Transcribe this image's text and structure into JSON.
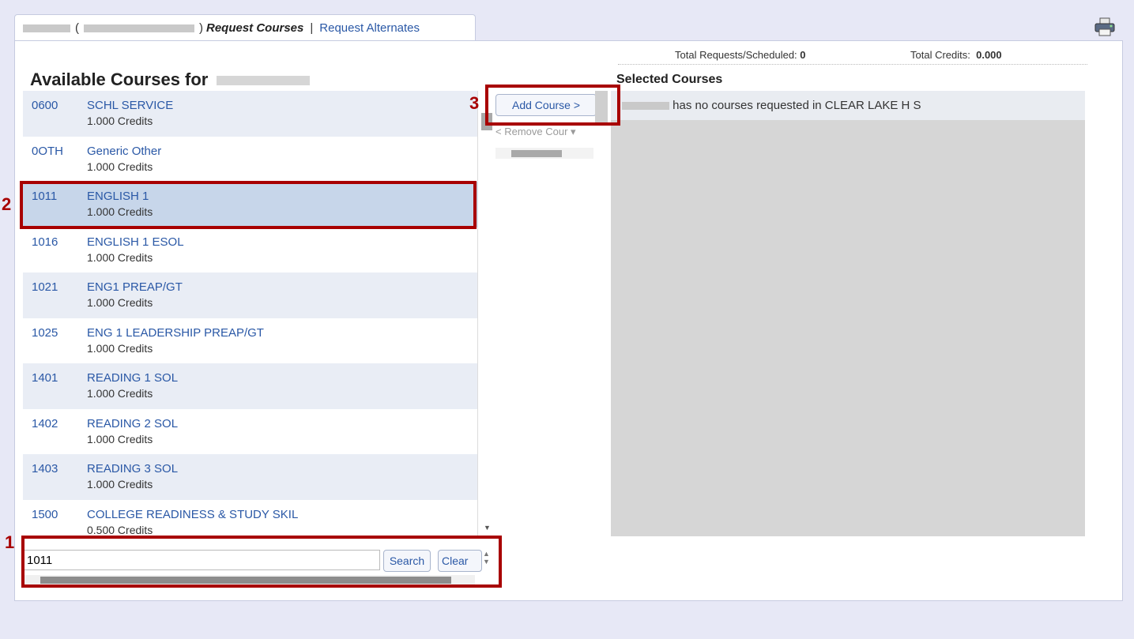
{
  "tabs": {
    "student_name_redacted": "",
    "open_paren": "(",
    "close_paren": ")",
    "active": "Request Courses",
    "separator": "|",
    "alternate": "Request Alternates"
  },
  "totals": {
    "requests_label": "Total Requests/Scheduled:",
    "requests_value": "0",
    "credits_label": "Total Credits:",
    "credits_value": "0.000"
  },
  "available": {
    "title": "Available Courses for",
    "courses": [
      {
        "code": "0600",
        "name": "SCHL SERVICE",
        "credits": "1.000 Credits"
      },
      {
        "code": "0OTH",
        "name": "Generic Other",
        "credits": "1.000 Credits"
      },
      {
        "code": "1011",
        "name": "ENGLISH 1",
        "credits": "1.000 Credits"
      },
      {
        "code": "1016",
        "name": "ENGLISH 1 ESOL",
        "credits": "1.000 Credits"
      },
      {
        "code": "1021",
        "name": "ENG1 PREAP/GT",
        "credits": "1.000 Credits"
      },
      {
        "code": "1025",
        "name": "ENG 1 LEADERSHIP PREAP/GT",
        "credits": "1.000 Credits"
      },
      {
        "code": "1401",
        "name": "READING 1 SOL",
        "credits": "1.000 Credits"
      },
      {
        "code": "1402",
        "name": "READING 2 SOL",
        "credits": "1.000 Credits"
      },
      {
        "code": "1403",
        "name": "READING 3 SOL",
        "credits": "1.000 Credits"
      },
      {
        "code": "1500",
        "name": "COLLEGE READINESS & STUDY SKIL",
        "credits": "0.500 Credits"
      }
    ]
  },
  "search": {
    "value": "1011",
    "search_label": "Search",
    "clear_label": "Clear"
  },
  "middle": {
    "add_label": "Add Course >",
    "remove_label": "< Remove Cour"
  },
  "selected": {
    "title": "Selected Courses",
    "message": "has no courses requested in CLEAR LAKE H S"
  },
  "callouts": {
    "n1": "1",
    "n2": "2",
    "n3": "3"
  },
  "colors": {
    "accent": "#a80000",
    "link": "#2a58a6",
    "background": "#e7e8f6"
  }
}
